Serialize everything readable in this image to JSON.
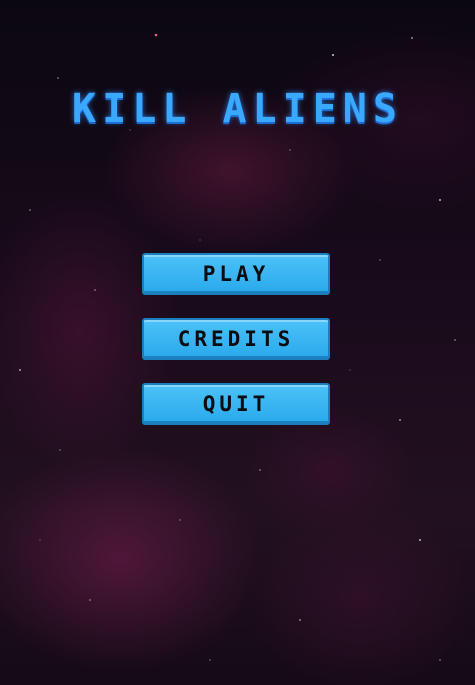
{
  "game": {
    "title": "KILL ALIENS"
  },
  "menu": {
    "play_label": "PLAY",
    "credits_label": "CREDITS",
    "quit_label": "QUIT"
  },
  "colors": {
    "title": "#3aa8ff",
    "button_fill": "#29a9ec",
    "button_border": "#1b7fbf",
    "button_text": "#0b0b10",
    "background": "#0a0610"
  }
}
